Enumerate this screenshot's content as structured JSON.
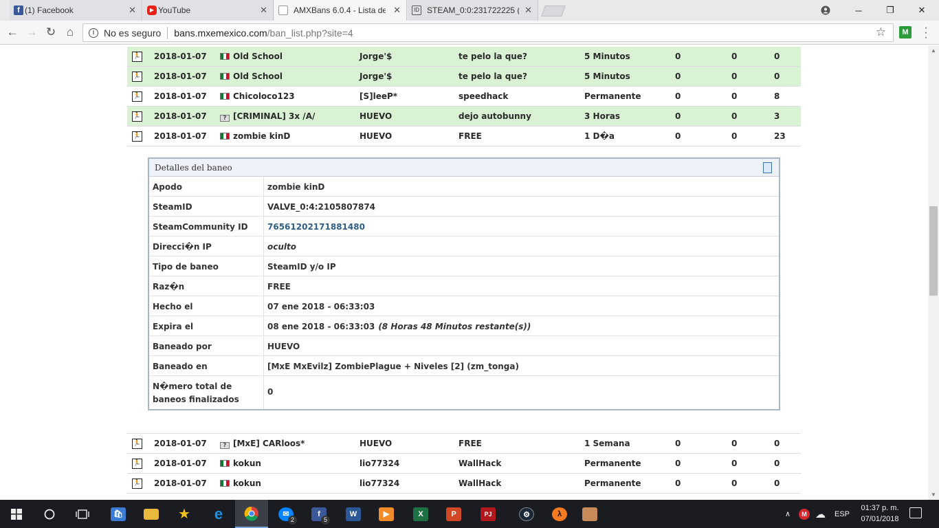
{
  "browser": {
    "tabs": [
      {
        "label": "(1) Facebook",
        "color": "#3b5998",
        "glyph": "f"
      },
      {
        "label": "YouTube",
        "color": "#e62117",
        "glyph": "▶"
      },
      {
        "label": "AMXBans 6.0.4 - Lista de",
        "color": "#777777",
        "glyph": ""
      },
      {
        "label": "STEAM_0:0:231722225 (C",
        "color": "#555555",
        "glyph": "ID"
      }
    ],
    "address": {
      "security": "No es seguro",
      "url_host": "bans.mxemexico.com",
      "url_path": "/ban_list.php?site=4"
    },
    "extension_label": "M"
  },
  "bans_top": [
    {
      "date": "2018-01-07",
      "flag": "mx",
      "player": "Old School",
      "admin": "Jorge'$",
      "reason": "te pelo la que?",
      "length": "5 Minutos",
      "c1": "0",
      "c2": "0",
      "c3": "0",
      "highlight": true
    },
    {
      "date": "2018-01-07",
      "flag": "mx",
      "player": "Old School",
      "admin": "Jorge'$",
      "reason": "te pelo la que?",
      "length": "5 Minutos",
      "c1": "0",
      "c2": "0",
      "c3": "0",
      "highlight": true
    },
    {
      "date": "2018-01-07",
      "flag": "mx",
      "player": "Chicoloco123",
      "admin": "[S]leeP*",
      "reason": "speedhack",
      "length": "Permanente",
      "c1": "0",
      "c2": "0",
      "c3": "8",
      "highlight": false
    },
    {
      "date": "2018-01-07",
      "flag": "unknown",
      "player": "[CRIMINAL] 3x /A/",
      "admin": "HUEVO",
      "reason": "dejo autobunny",
      "length": "3 Horas",
      "c1": "0",
      "c2": "0",
      "c3": "3",
      "highlight": true
    },
    {
      "date": "2018-01-07",
      "flag": "mx",
      "player": "zombie kinD",
      "admin": "HUEVO",
      "reason": "FREE",
      "length": "1 D�a",
      "c1": "0",
      "c2": "0",
      "c3": "23",
      "highlight": false
    }
  ],
  "details": {
    "title": "Detalles del baneo",
    "rows": [
      {
        "key": "Apodo",
        "value": "zombie kinD"
      },
      {
        "key": "SteamID",
        "value": "VALVE_0:4:2105807874"
      },
      {
        "key": "SteamCommunity ID",
        "value": "76561202171881480"
      },
      {
        "key": "Direcci�n IP",
        "value": "oculto"
      },
      {
        "key": "Tipo de baneo",
        "value": "SteamID y/o IP"
      },
      {
        "key": "Raz�n",
        "value": "FREE"
      },
      {
        "key": "Hecho el",
        "value": "07 ene 2018 - 06:33:03"
      },
      {
        "key": "Expira el",
        "value": "08 ene 2018 - 06:33:03",
        "extra": "(8 Horas 48 Minutos restante(s))"
      },
      {
        "key": "Baneado por",
        "value": "HUEVO"
      },
      {
        "key": "Baneado en",
        "value": "[MxE MxEvilz] ZombiePlague + Niveles [2] (zm_tonga)"
      },
      {
        "key": "N�mero total de baneos finalizados",
        "value": "0"
      }
    ]
  },
  "bans_bottom": [
    {
      "date": "2018-01-07",
      "flag": "unknown",
      "player": "[MxE] CARloos*",
      "admin": "HUEVO",
      "reason": "FREE",
      "length": "1 Semana",
      "c1": "0",
      "c2": "0",
      "c3": "0",
      "highlight": false
    },
    {
      "date": "2018-01-07",
      "flag": "mx",
      "player": "kokun",
      "admin": "lio77324",
      "reason": "WallHack",
      "length": "Permanente",
      "c1": "0",
      "c2": "0",
      "c3": "0",
      "highlight": false
    },
    {
      "date": "2018-01-07",
      "flag": "mx",
      "player": "kokun",
      "admin": "lio77324",
      "reason": "WallHack",
      "length": "Permanente",
      "c1": "0",
      "c2": "0",
      "c3": "0",
      "highlight": false
    }
  ],
  "taskbar": {
    "badges": {
      "messenger": "2",
      "facebook": "5"
    },
    "tray_lang": "ESP",
    "clock_time": "01:37 p. m.",
    "clock_date": "07/01/2018"
  },
  "colors": {
    "highlight_row": "#d9f2d4",
    "link": "#2f5d86",
    "panel_border": "#a8b6c8"
  }
}
